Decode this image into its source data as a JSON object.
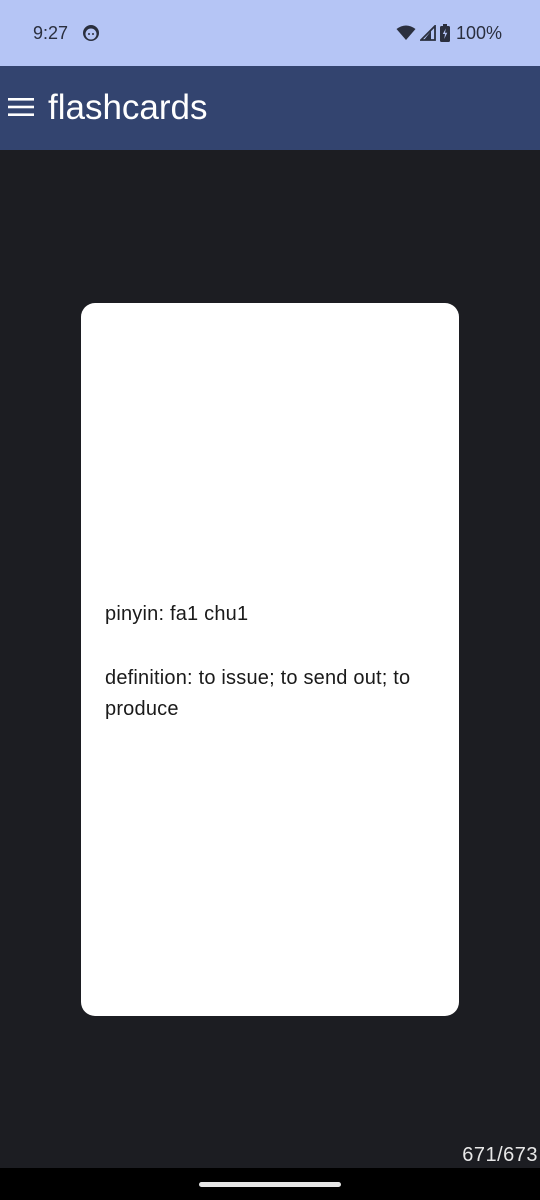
{
  "status_bar": {
    "time": "9:27",
    "battery_percent": "100%"
  },
  "app_bar": {
    "title": "flashcards",
    "menu_icon": "hamburger-menu-icon"
  },
  "card": {
    "pinyin": "pinyin: fa1 chu1",
    "definition": "definition: to issue; to send out; to produce"
  },
  "progress": {
    "counter": "671/673"
  },
  "colors": {
    "status_bar_bg": "#b5c5f5",
    "app_bar_bg": "#33446f",
    "screen_bg": "#1c1d22",
    "card_bg": "#ffffff"
  }
}
